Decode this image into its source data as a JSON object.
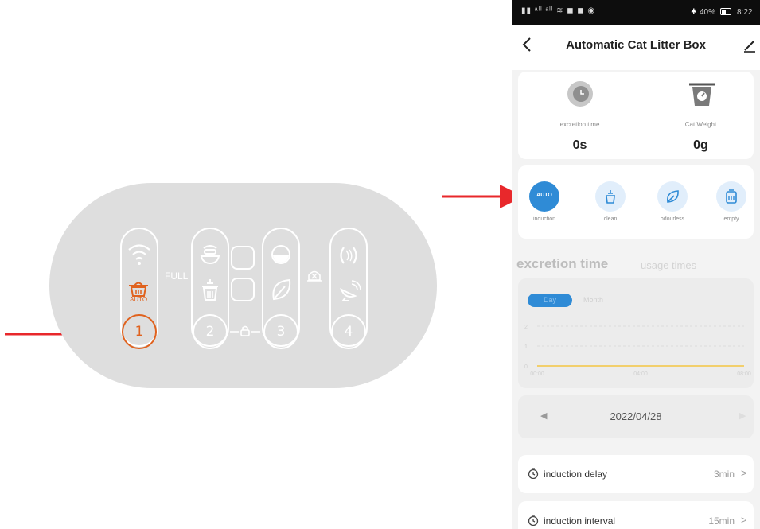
{
  "panel": {
    "full_label": "FULL",
    "auto_label": "AUTO",
    "buttons": [
      "1",
      "2",
      "3",
      "4"
    ]
  },
  "phone": {
    "status": {
      "battery": "40%",
      "time": "8:22"
    },
    "header": {
      "title": "Automatic Cat Litter Box"
    },
    "stats": [
      {
        "label": "excretion time",
        "value": "0s",
        "icon": "clock-icon"
      },
      {
        "label": "Cat Weight",
        "value": "0g",
        "icon": "scale-icon"
      }
    ],
    "modes": [
      {
        "label": "induction",
        "icon_text": "AUTO",
        "active": true
      },
      {
        "label": "clean",
        "icon": "clean-icon",
        "active": false
      },
      {
        "label": "odourless",
        "icon": "leaf-icon",
        "active": false
      },
      {
        "label": "empty",
        "icon": "bin-icon",
        "active": false
      }
    ],
    "chart_tabs": {
      "active": "excretion time",
      "inactive": "usage times"
    },
    "range_tabs": {
      "day": "Day",
      "month": "Month"
    },
    "chart_data": {
      "type": "line",
      "x_ticks": [
        "00:00",
        "04:00",
        "08:00"
      ],
      "y_ticks": [
        "2",
        "1",
        "0"
      ],
      "series": [
        {
          "values": [
            0,
            0,
            0
          ]
        }
      ]
    },
    "date": "2022/04/28",
    "settings": [
      {
        "label": "induction delay",
        "value": "3min"
      },
      {
        "label": "induction interval",
        "value": "15min"
      }
    ],
    "colors": {
      "accent": "#2f8bd6",
      "line": "#f4c542",
      "arrow": "#e8282b",
      "panel_orange": "#e0621e"
    }
  }
}
